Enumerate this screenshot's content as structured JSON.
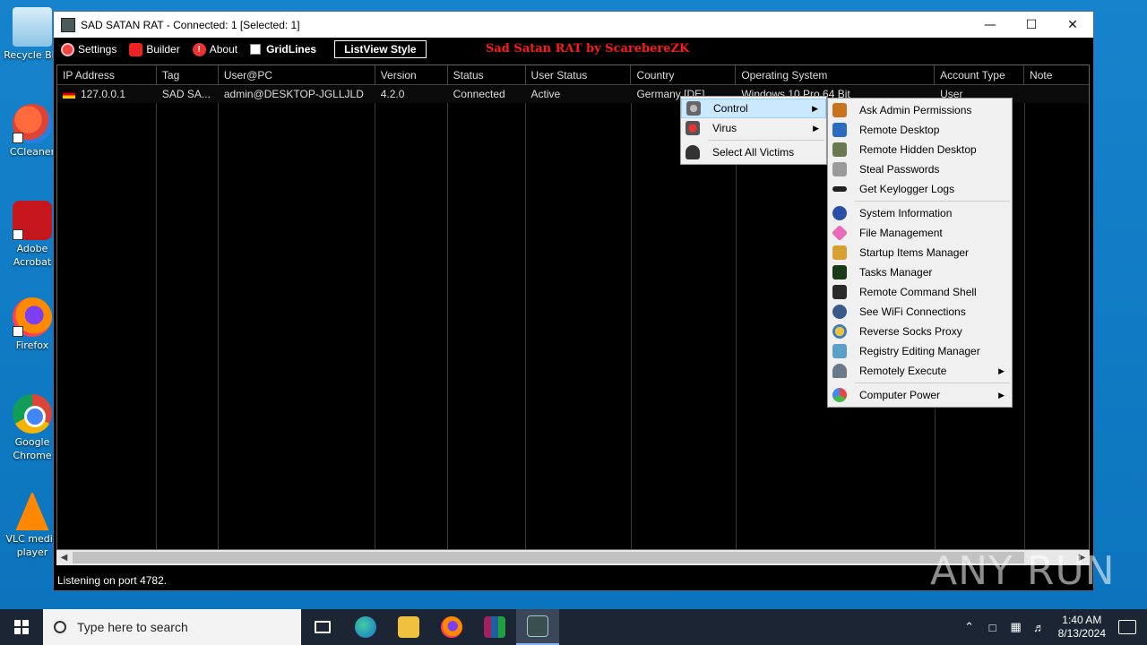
{
  "desktop": {
    "icons": [
      {
        "label": "Recycle Bin",
        "icon": "recycle-bin-icon"
      },
      {
        "label": "CCleaner",
        "icon": "ccleaner-icon"
      },
      {
        "label": "Adobe Acrobat",
        "icon": "acrobat-icon"
      },
      {
        "label": "Firefox",
        "icon": "firefox-icon"
      },
      {
        "label": "Google Chrome",
        "icon": "chrome-icon"
      },
      {
        "label": "VLC media player",
        "icon": "vlc-icon"
      }
    ]
  },
  "window": {
    "title": "SAD SATAN RAT - Connected: 1 [Selected: 1]",
    "minimize": "—",
    "maximize": "☐",
    "close": "✕"
  },
  "toolbar": {
    "settings": "Settings",
    "builder": "Builder",
    "about": "About",
    "gridlines": "GridLines",
    "listview_style": "ListView Style",
    "brand": "Sad Satan RAT by ScarebereZK"
  },
  "table": {
    "columns": [
      "IP Address",
      "Tag",
      "User@PC",
      "Version",
      "Status",
      "User Status",
      "Country",
      "Operating System",
      "Account Type",
      "Note"
    ],
    "rows": [
      {
        "ip": "127.0.0.1",
        "tag": "SAD SA...",
        "user_pc": "admin@DESKTOP-JGLLJLD",
        "version": "4.2.0",
        "status": "Connected",
        "user_status": "Active",
        "country": "Germany [DE]",
        "os": "Windows 10 Pro 64 Bit",
        "account_type": "User",
        "note": ""
      }
    ]
  },
  "status_bar": "Listening on port 4782.",
  "context_menu": {
    "items": [
      "Control",
      "Virus",
      "Select All Victims"
    ]
  },
  "control_submenu": {
    "group1": [
      "Ask Admin Permissions",
      "Remote Desktop",
      "Remote Hidden Desktop",
      "Steal Passwords",
      "Get Keylogger Logs"
    ],
    "group2": [
      "System Information",
      "File Management",
      "Startup Items Manager",
      "Tasks Manager",
      "Remote Command Shell",
      "See WiFi Connections",
      "Reverse Socks Proxy",
      "Registry Editing Manager",
      "Remotely Execute"
    ],
    "group3": [
      "Computer Power"
    ]
  },
  "taskbar": {
    "search_placeholder": "Type here to search",
    "time": "1:40 AM",
    "date": "8/13/2024"
  },
  "watermark": "ANY RUN"
}
